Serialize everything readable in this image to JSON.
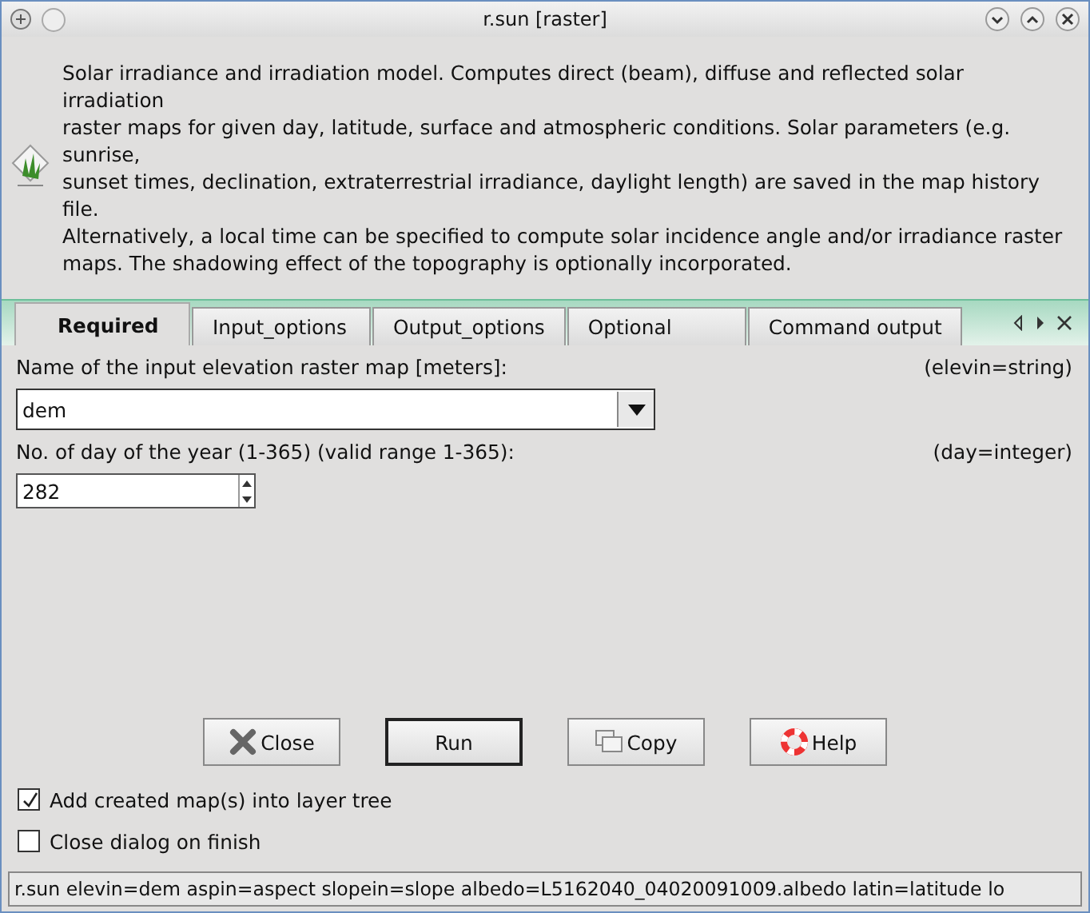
{
  "window": {
    "title": "r.sun [raster]"
  },
  "description": [
    "Solar irradiance and irradiation model. Computes direct (beam), diffuse and reflected solar irradiation",
    "raster maps for given day, latitude, surface and atmospheric conditions. Solar parameters (e.g. sunrise,",
    "sunset times, declination, extraterrestrial irradiance, daylight length) are saved in the map history file.",
    "Alternatively, a local time can be specified to compute solar incidence angle and/or irradiance raster",
    "maps. The shadowing effect of the topography is optionally incorporated."
  ],
  "tabs": [
    {
      "label": "Required",
      "selected": true
    },
    {
      "label": "Input_options",
      "selected": false
    },
    {
      "label": "Output_options",
      "selected": false
    },
    {
      "label": "Optional",
      "selected": false
    },
    {
      "label": "Command output",
      "selected": false
    }
  ],
  "fields": [
    {
      "kind": "combo",
      "label": "Name of the input elevation raster map [meters]:",
      "param": "(elevin=string)",
      "value": "dem"
    },
    {
      "kind": "spin",
      "label": "No. of day of the year (1-365) (valid range 1-365):",
      "param": "(day=integer)",
      "value": "282"
    }
  ],
  "buttons": [
    {
      "kind": "close",
      "label": "Close"
    },
    {
      "kind": "run",
      "label": "Run"
    },
    {
      "kind": "copy",
      "label": "Copy"
    },
    {
      "kind": "help",
      "label": "Help"
    }
  ],
  "checkboxes": [
    {
      "label": "Add created map(s) into layer tree",
      "checked": true
    },
    {
      "label": "Close dialog on finish",
      "checked": false
    }
  ],
  "status_bar": "r.sun elevin=dem aspin=aspect slopein=slope albedo=L5162040_04020091009.albedo latin=latitude lo"
}
